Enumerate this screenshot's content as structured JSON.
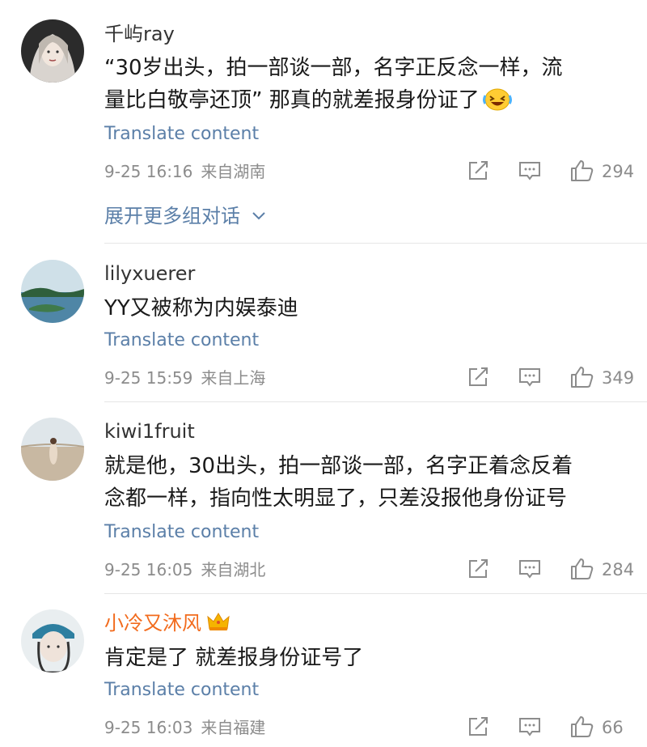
{
  "translate_label": "Translate content",
  "comments": [
    {
      "username": "千屿ray",
      "text_lines": [
        "“30岁出头，拍一部谈一部，名字正反念一样，流",
        "量比白敬亭还顶” 那真的就差报身份证了"
      ],
      "has_emoji": true,
      "emoji_name": "laughing-crying-emoji",
      "time": "9-25 16:16",
      "location": "来自湖南",
      "likes": "294",
      "expand_label": "展开更多组对话"
    },
    {
      "username": "lilyxuerer",
      "text_lines": [
        "YY又被称为内娱泰迪"
      ],
      "time": "9-25 15:59",
      "location": "来自上海",
      "likes": "349"
    },
    {
      "username": "kiwi1fruit",
      "text_lines": [
        "就是他，30出头，拍一部谈一部，名字正着念反着",
        "念都一样，指向性太明显了，只差没报他身份证号"
      ],
      "time": "9-25 16:05",
      "location": "来自湖北",
      "likes": "284"
    },
    {
      "username": "小冷又沐风",
      "is_vip": true,
      "vip_icon": "crown-icon",
      "text_lines": [
        "肯定是了 就差报身份证号了"
      ],
      "time": "9-25 16:03",
      "location": "来自福建",
      "likes": "66"
    }
  ],
  "colors": {
    "link": "#5b7fa8",
    "vip_name": "#f26b1d",
    "meta": "#8c8c8c"
  }
}
